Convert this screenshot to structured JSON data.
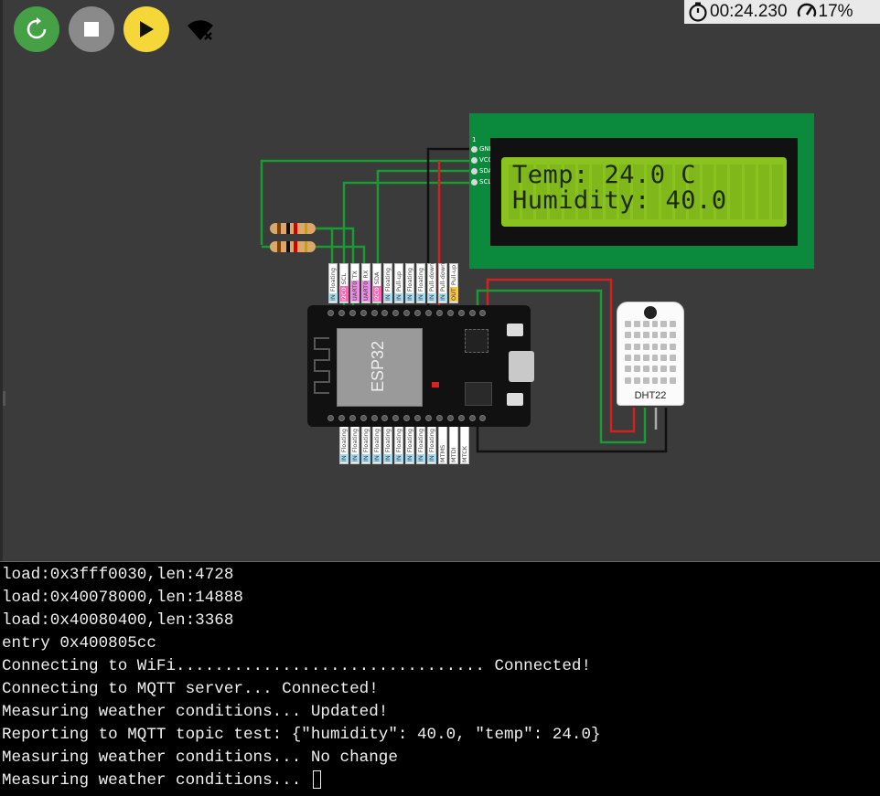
{
  "toolbar": {
    "restart_icon": "restart-icon",
    "stop_icon": "stop-icon",
    "play_icon": "play-icon",
    "wifi_icon": "wifi-off-icon"
  },
  "status": {
    "timer": "00:24.230",
    "speed": "17%"
  },
  "lcd": {
    "line1": "Temp: 24.0 C",
    "line2": "Humidity: 40.0",
    "pin_index": "1",
    "pins": [
      "GND",
      "VCC",
      "SDA",
      "SCL"
    ],
    "backlight_color": "#8ac21f",
    "board_color": "#0b8a3e"
  },
  "esp32": {
    "label": "ESP32",
    "top_pins": [
      {
        "mode": "IN",
        "func": "Floating"
      },
      {
        "mode": "I2C0",
        "func": "SCL"
      },
      {
        "mode": "UART0",
        "func": "TX"
      },
      {
        "mode": "UART0",
        "func": "RX"
      },
      {
        "mode": "I2C0",
        "func": "SDA"
      },
      {
        "mode": "IN",
        "func": "Floating"
      },
      {
        "mode": "IN",
        "func": "Pull-up"
      },
      {
        "mode": "IN",
        "func": "Floating"
      },
      {
        "mode": "IN",
        "func": "Floating"
      },
      {
        "mode": "IN",
        "func": "Pull-down"
      },
      {
        "mode": "IN",
        "func": "Pull-down"
      },
      {
        "mode": "OUT",
        "func": "Pull-up"
      }
    ],
    "bottom_pins": [
      {
        "mode": "IN",
        "func": "Floating"
      },
      {
        "mode": "IN",
        "func": "Floating"
      },
      {
        "mode": "IN",
        "func": "Floating"
      },
      {
        "mode": "IN",
        "func": "Floating"
      },
      {
        "mode": "IN",
        "func": "Floating"
      },
      {
        "mode": "IN",
        "func": "Floating"
      },
      {
        "mode": "IN",
        "func": "Floating"
      },
      {
        "mode": "IN",
        "func": "Floating"
      },
      {
        "mode": "IN",
        "func": "Floating"
      },
      {
        "mode": "",
        "func": "MTMS"
      },
      {
        "mode": "",
        "func": "MTDI"
      },
      {
        "mode": "",
        "func": "MTCK"
      }
    ]
  },
  "sensor": {
    "label": "DHT22"
  },
  "terminal": {
    "lines": [
      "load:0x3fff0030,len:4728",
      "load:0x40078000,len:14888",
      "load:0x40080400,len:3368",
      "entry 0x400805cc",
      "Connecting to WiFi................................ Connected!",
      "Connecting to MQTT server... Connected!",
      "Measuring weather conditions... Updated!",
      "Reporting to MQTT topic test: {\"humidity\": 40.0, \"temp\": 24.0}",
      "Measuring weather conditions... No change",
      "Measuring weather conditions... "
    ]
  }
}
